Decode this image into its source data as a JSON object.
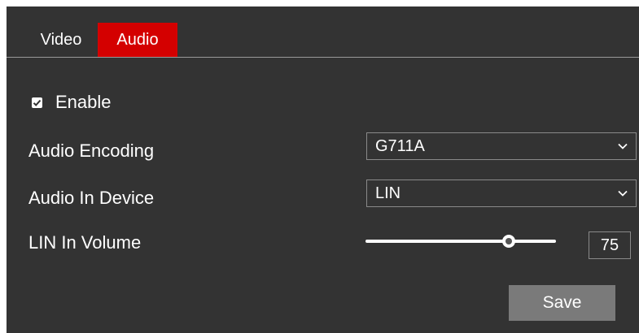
{
  "tabs": [
    {
      "label": "Video",
      "active": false
    },
    {
      "label": "Audio",
      "active": true
    }
  ],
  "colors": {
    "panel_bg": "#333333",
    "active_tab": "#d40000",
    "button_bg": "#7a7a7a",
    "text": "#ffffff"
  },
  "enable": {
    "label": "Enable",
    "checked": true,
    "icon": "checkmark-icon"
  },
  "audio_encoding": {
    "label": "Audio Encoding",
    "value": "G711A",
    "icon": "chevron-down-icon"
  },
  "audio_in_device": {
    "label": "Audio In Device",
    "value": "LIN",
    "icon": "chevron-down-icon"
  },
  "lin_in_volume": {
    "label": "LIN In Volume",
    "value": "75",
    "level_fraction": 0.75
  },
  "save_label": "Save"
}
